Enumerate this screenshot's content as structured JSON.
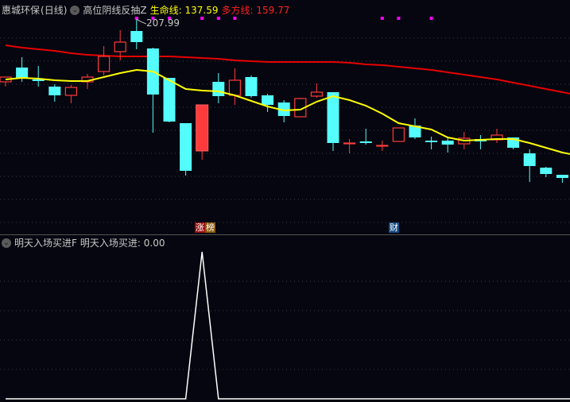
{
  "header": {
    "stock_name": "惠城环保",
    "period": "(日线)",
    "indicator_name": "高位阴线反抽Z",
    "life_line_label": "生命线:",
    "life_line_value": "137.59",
    "multi_line_label": "多方线:",
    "multi_line_value": "159.77"
  },
  "sub_header": {
    "indicator_name": "明天入场买进F",
    "value_label": "明天入场买进:",
    "value": "0.00"
  },
  "badges": {
    "zhangbang": [
      "涨",
      "榜"
    ],
    "cai": "财"
  },
  "max_price_label": "207.99",
  "colors": {
    "background": "#05060f",
    "up": "#ff3b3b",
    "down": "#54fcfc",
    "life_line": "#ffff00",
    "multi_line": "#e80000",
    "signal_dot": "#ff00ff",
    "indicator_line": "#ffffff",
    "grid": "#3a3a48"
  },
  "chart_data": {
    "type": "candlestick",
    "candles": [
      {
        "o": 168.5,
        "c": 171.5,
        "h": 171.5,
        "l": 165.5
      },
      {
        "o": 177.5,
        "c": 170.5,
        "h": 184,
        "l": 168.5
      },
      {
        "o": 170,
        "c": 169,
        "h": 178.5,
        "l": 165.5
      },
      {
        "o": 165.5,
        "c": 160,
        "h": 167,
        "l": 156
      },
      {
        "o": 160,
        "c": 165,
        "h": 166.5,
        "l": 155
      },
      {
        "o": 168.5,
        "c": 171.5,
        "h": 173.5,
        "l": 164
      },
      {
        "o": 175,
        "c": 184.5,
        "h": 191,
        "l": 172.5
      },
      {
        "o": 187.5,
        "c": 193.5,
        "h": 201,
        "l": 182
      },
      {
        "o": 200.5,
        "c": 193.5,
        "h": 207.99,
        "l": 189
      },
      {
        "o": 189.5,
        "c": 160.5,
        "h": 190,
        "l": 136.5
      },
      {
        "o": 171,
        "c": 143.5,
        "h": 171,
        "l": 143
      },
      {
        "o": 142.5,
        "c": 112.5,
        "h": 142.5,
        "l": 109.5
      },
      {
        "o": 125,
        "c": 154,
        "h": 154,
        "l": 119.5,
        "filled": true
      },
      {
        "o": 168.5,
        "c": 159.5,
        "h": 174,
        "l": 155
      },
      {
        "o": 160,
        "c": 169.5,
        "h": 177,
        "l": 154
      },
      {
        "o": 171.5,
        "c": 159.5,
        "h": 172.5,
        "l": 158.5
      },
      {
        "o": 160,
        "c": 154,
        "h": 161,
        "l": 149.5
      },
      {
        "o": 155.5,
        "c": 147,
        "h": 157,
        "l": 143
      },
      {
        "o": 146.5,
        "c": 158,
        "h": 158.5,
        "l": 146.5
      },
      {
        "o": 159.5,
        "c": 162,
        "h": 167.5,
        "l": 158.5
      },
      {
        "o": 162,
        "c": 130,
        "h": 162,
        "l": 125
      },
      {
        "o": 129.5,
        "c": 130,
        "h": 132.5,
        "l": 123.5
      },
      {
        "o": 131,
        "c": 130,
        "h": 139,
        "l": 129
      },
      {
        "o": 128.5,
        "c": 128.5,
        "h": 131.5,
        "l": 125
      },
      {
        "o": 131,
        "c": 139.5,
        "h": 139.5,
        "l": 131
      },
      {
        "o": 141,
        "c": 133.5,
        "h": 145.5,
        "l": 132.5
      },
      {
        "o": 131.5,
        "c": 130.5,
        "h": 134,
        "l": 126
      },
      {
        "o": 131.5,
        "c": 129,
        "h": 134,
        "l": 124
      },
      {
        "o": 129.5,
        "c": 133,
        "h": 137,
        "l": 126
      },
      {
        "o": 132.5,
        "c": 131,
        "h": 135,
        "l": 126
      },
      {
        "o": 132,
        "c": 135,
        "h": 139,
        "l": 130
      },
      {
        "o": 133.5,
        "c": 127,
        "h": 133.5,
        "l": 126
      },
      {
        "o": 123.5,
        "c": 115.5,
        "h": 126,
        "l": 105.5
      },
      {
        "o": 114.5,
        "c": 110.5,
        "h": 115,
        "l": 108.5
      },
      {
        "o": 110,
        "c": 108,
        "h": 110,
        "l": 105
      },
      {
        "o": 113.5,
        "c": 114,
        "h": 114.5,
        "l": 113
      }
    ],
    "life_line": [
      170,
      171,
      170.5,
      169.5,
      169,
      169,
      171.5,
      174,
      176,
      175,
      169.5,
      164,
      163,
      162.5,
      160,
      156.5,
      153,
      150.5,
      151,
      156,
      159.5,
      157,
      153.5,
      148.5,
      142.5,
      140.5,
      138.5,
      133.5,
      131.5,
      132,
      132.5,
      132.5,
      130,
      127,
      124,
      122
    ],
    "multi_line": [
      191.5,
      190,
      189,
      188,
      186.5,
      185.5,
      185,
      184.5,
      184.5,
      184.5,
      184.5,
      184,
      183.5,
      183,
      182,
      181.5,
      181,
      181,
      181,
      181,
      181,
      180.5,
      179.5,
      179,
      178,
      177,
      176,
      174.5,
      173,
      171.5,
      170,
      168,
      166,
      164,
      162,
      160
    ],
    "signal_dots": [
      8,
      9,
      10,
      12,
      13,
      14,
      23,
      24,
      26
    ],
    "indicator_values": [
      0,
      0,
      0,
      0,
      0,
      0,
      0,
      0,
      0,
      0,
      0,
      0,
      1,
      0,
      0,
      0,
      0,
      0,
      0,
      0,
      0,
      0,
      0,
      0,
      0,
      0,
      0,
      0,
      0,
      0,
      0,
      0,
      0,
      0,
      0,
      0
    ],
    "indicator_ylim": [
      0,
      1
    ],
    "max_price_index": 8,
    "grid": true
  }
}
